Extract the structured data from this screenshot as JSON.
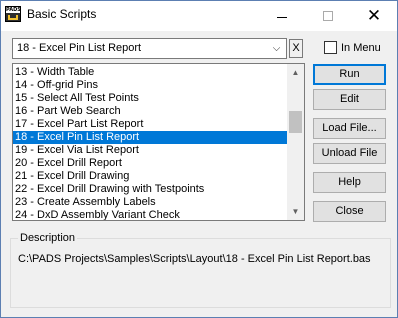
{
  "window": {
    "title": "Basic Scripts",
    "icon_text": "PADS",
    "minimize_glyph": "—",
    "maximize_glyph": "☐",
    "close_glyph": "✕"
  },
  "script_select": {
    "value": "18 - Excel Pin List Report",
    "clear_label": "X"
  },
  "in_menu": {
    "label": "In Menu",
    "checked": false
  },
  "script_list": {
    "items": [
      "13 - Width Table",
      "14 - Off-grid Pins",
      "15 - Select All Test Points",
      "16 - Part Web Search",
      "17 - Excel Part List Report",
      "18 - Excel Pin List Report",
      "19 - Excel Via List Report",
      "20 - Excel Drill Report",
      "21 - Excel Drill Drawing",
      "22 - Excel Drill Drawing with Testpoints",
      "23 - Create Assembly Labels",
      "24 - DxD Assembly Variant Check"
    ],
    "selected_index": 5
  },
  "buttons": {
    "run": "Run",
    "edit": "Edit",
    "load_file": "Load File...",
    "unload_file": "Unload File",
    "help": "Help",
    "close": "Close"
  },
  "description": {
    "label": "Description",
    "text": "C:\\PADS Projects\\Samples\\Scripts\\Layout\\18 - Excel Pin List Report.bas"
  },
  "colors": {
    "selection": "#0078d7",
    "default_button_border": "#0078d7"
  }
}
